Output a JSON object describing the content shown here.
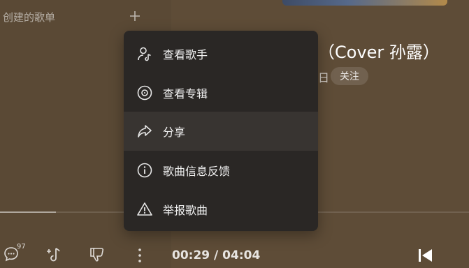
{
  "sidebar": {
    "playlist_heading": "创建的歌单"
  },
  "song": {
    "title_fragment": "（Cover 孙露）",
    "artist_fragment": "日",
    "follow_label": "关注"
  },
  "player": {
    "comment_count": "97",
    "current_time": "00:29",
    "total_time": "04:04",
    "time_display": "00:29 / 04:04",
    "progress_fraction": 0.119
  },
  "context_menu": {
    "items": [
      {
        "label": "查看歌手",
        "icon": "singer-icon"
      },
      {
        "label": "查看专辑",
        "icon": "album-disc-icon"
      },
      {
        "label": "分享",
        "icon": "share-icon"
      },
      {
        "label": "歌曲信息反馈",
        "icon": "info-icon"
      },
      {
        "label": "举报歌曲",
        "icon": "warning-icon"
      }
    ],
    "highlighted_index": 2
  },
  "colors": {
    "background": "#5b4a36",
    "menu_background": "#2a2725",
    "menu_highlight": "#383431"
  }
}
